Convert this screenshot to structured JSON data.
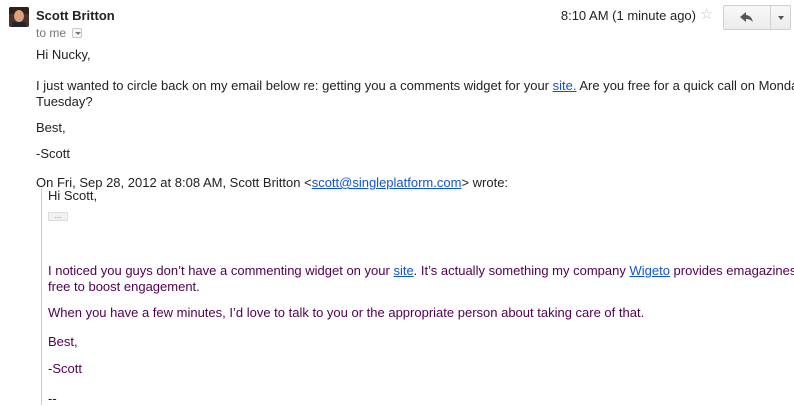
{
  "header": {
    "sender_name": "Scott Britton",
    "to_label": "to me",
    "timestamp": "8:10 AM (1 minute ago)"
  },
  "icons": {
    "avatar": "avatar-photo",
    "star": "star-icon",
    "reply": "reply-icon",
    "more": "chevron-down-icon",
    "details": "dropdown-arrow-icon"
  },
  "message": {
    "greeting": "Hi Nucky,",
    "line1_before": "I just wanted to circle back on my email below re: getting you a comments widget for your ",
    "line1_link": "site.",
    "line1_after": " Are you free for a quick call on Monday or",
    "line2": "Tuesday?",
    "closing": "Best,",
    "signature": "-Scott"
  },
  "quote": {
    "attribution_before": "On Fri, Sep 28, 2012 at 8:08 AM, Scott Britton <",
    "attribution_email": "scott@singleplatform.com",
    "attribution_after": "> wrote:",
    "greeting": "Hi Scott,",
    "ellipsis": "...",
    "p1_a": "I noticed you guys don’t have a commenting widget on your ",
    "p1_link1": "site",
    "p1_b": ". It’s actually something my company ",
    "p1_link2": "Wigeto",
    "p1_c": " provides emagazines for",
    "p1_line2": "free to boost engagement.",
    "p2": "When you have a few minutes, I’d love to talk to you or the appropriate person about taking care of that.",
    "closing": "Best,",
    "signature": "-Scott",
    "sig_separator": "--"
  },
  "colors": {
    "link": "#1155cc",
    "quoted_text": "#500050",
    "quote_bar": "#cccccc"
  }
}
